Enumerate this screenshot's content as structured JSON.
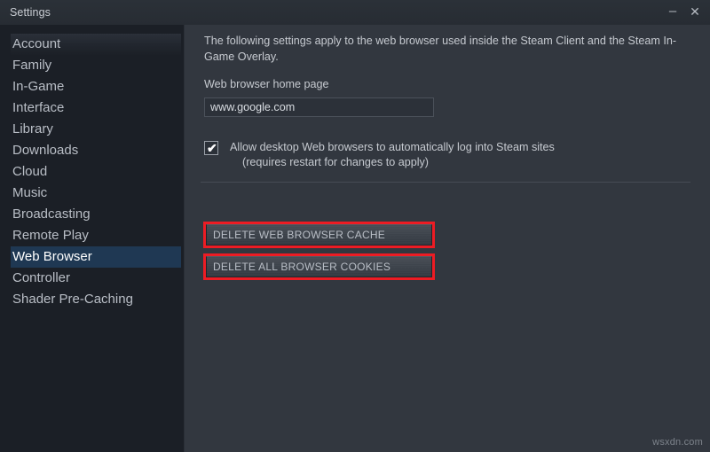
{
  "window": {
    "title": "Settings",
    "minimize_label": "–",
    "close_label": "✕"
  },
  "sidebar": {
    "items": [
      {
        "label": "Account",
        "selected": false
      },
      {
        "label": "Family",
        "selected": false
      },
      {
        "label": "In-Game",
        "selected": false
      },
      {
        "label": "Interface",
        "selected": false
      },
      {
        "label": "Library",
        "selected": false
      },
      {
        "label": "Downloads",
        "selected": false
      },
      {
        "label": "Cloud",
        "selected": false
      },
      {
        "label": "Music",
        "selected": false
      },
      {
        "label": "Broadcasting",
        "selected": false
      },
      {
        "label": "Remote Play",
        "selected": false
      },
      {
        "label": "Web Browser",
        "selected": true
      },
      {
        "label": "Controller",
        "selected": false
      },
      {
        "label": "Shader Pre-Caching",
        "selected": false
      }
    ]
  },
  "content": {
    "intro": "The following settings apply to the web browser used inside the Steam Client and the Steam In-Game Overlay.",
    "home_page_label": "Web browser home page",
    "home_page_value": "www.google.com",
    "home_page_placeholder": "",
    "checkbox": {
      "checked": true,
      "tick_glyph": "✔",
      "line1": "Allow desktop Web browsers to automatically log into Steam sites",
      "line2": "(requires restart for changes to apply)"
    },
    "buttons": {
      "delete_cache": "DELETE WEB BROWSER CACHE",
      "delete_cookies": "DELETE ALL BROWSER COOKIES"
    }
  },
  "annotations": {
    "color": "#ed1c24",
    "targets": [
      "delete-web-browser-cache-button",
      "delete-all-browser-cookies-button"
    ]
  },
  "watermark": "wsxdn.com"
}
